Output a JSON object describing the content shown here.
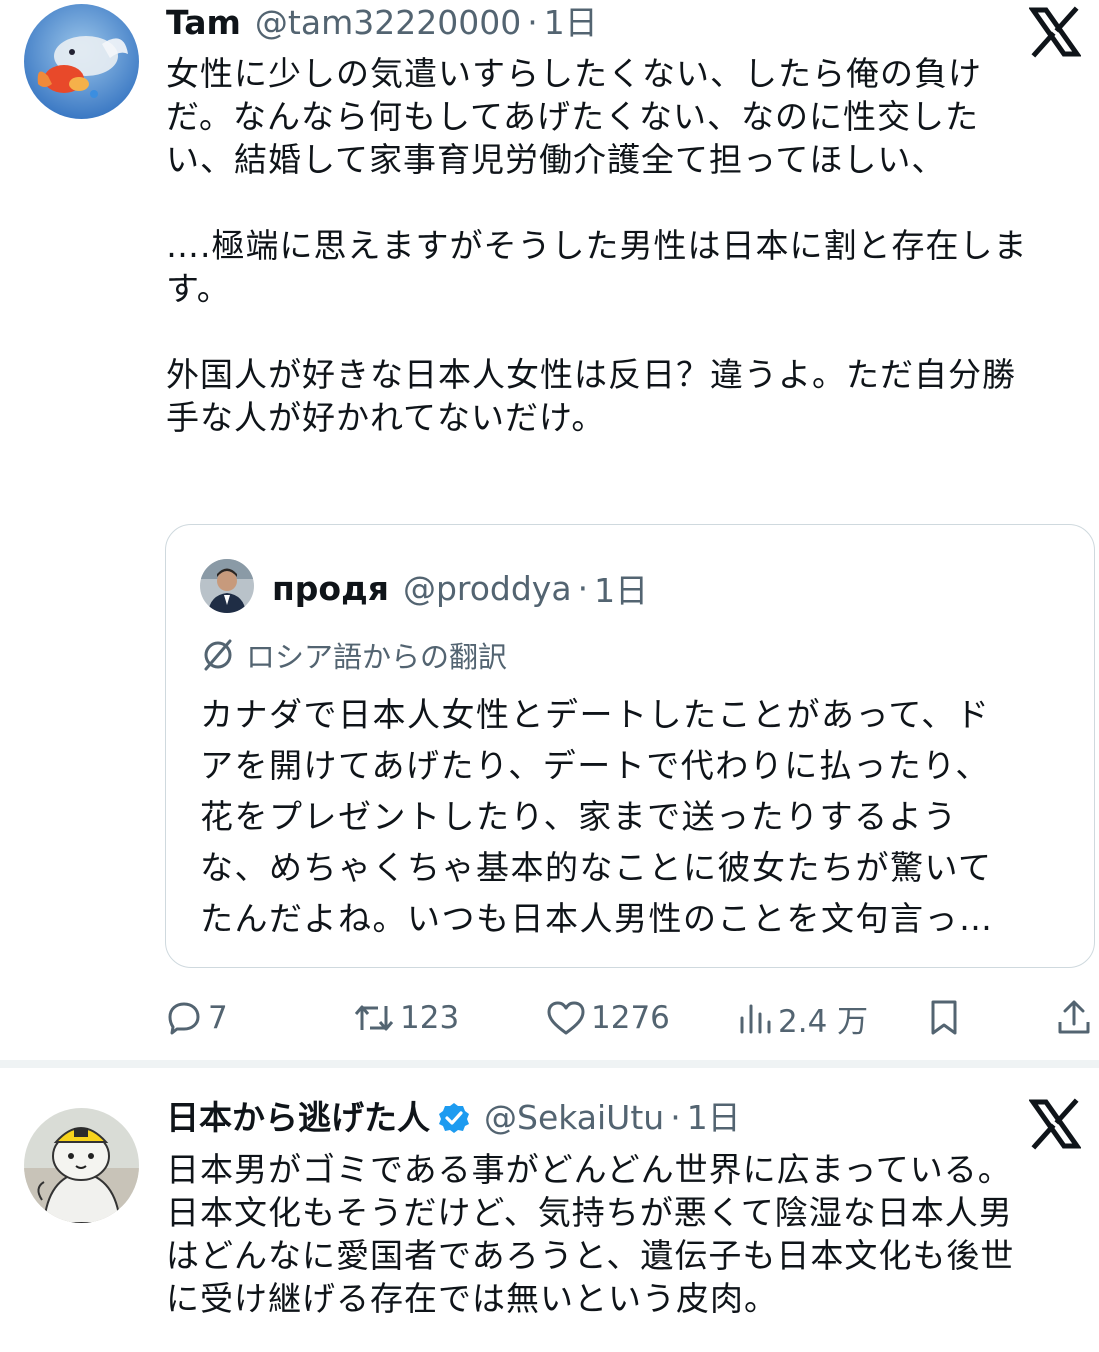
{
  "post1": {
    "author_name": "Tam",
    "handle": "@tam32220000",
    "separator": "·",
    "date": "1日",
    "text_lines": [
      "女性に少しの気遣いすらしたくない、したら俺の負け",
      "だ。なんなら何もしてあげたくない、なのに性交した",
      "い、結婚して家事育児労働介護全て担ってほしい、",
      "",
      "….極端に思えますがそうした男性は日本に割と存在しま",
      "す。",
      "",
      "外国人が好きな日本人女性は反日？違うよ。ただ自分勝",
      "手な人が好かれてないだけ。"
    ],
    "quote": {
      "author_name": "продя",
      "handle": "@proddya",
      "separator": "·",
      "date": "1日",
      "translation_label": "ロシア語からの翻訳",
      "text_lines": [
        "カナダで日本人女性とデートしたことがあって、ド",
        "アを開けてあげたり、デートで代わりに払ったり、",
        "花をプレゼントしたり、家まで送ったりするよう",
        "な、めちゃくちゃ基本的なことに彼女たちが驚いて",
        "たんだよね。いつも日本人男性のことを文句言っ…"
      ]
    },
    "actions": {
      "replies": "7",
      "reposts": "123",
      "likes": "1276",
      "views": "2.4 万"
    }
  },
  "post2": {
    "author_name": "日本から逃げた人",
    "handle": "@SekaiUtu",
    "separator": "·",
    "date": "1日",
    "text_lines": [
      "日本男がゴミである事がどんどん世界に広まっている。",
      "日本文化もそうだけど、気持ちが悪くて陰湿な日本人男",
      "はどんなに愛国者であろうと、遺伝子も日本文化も後世",
      "に受け継げる存在では無いという皮肉。"
    ]
  },
  "icons": {
    "brand": "x-logo-icon",
    "verified": "verified-badge-icon",
    "reply": "reply-icon",
    "repost": "repost-icon",
    "like": "heart-icon",
    "views": "views-icon",
    "bookmark": "bookmark-icon",
    "share": "share-icon",
    "translate": "translate-icon"
  },
  "colors": {
    "text_primary": "#0f1419",
    "text_secondary": "#536471",
    "border": "#cfd9de",
    "verified_blue": "#1d9bf0",
    "divider": "#eff3f4"
  }
}
